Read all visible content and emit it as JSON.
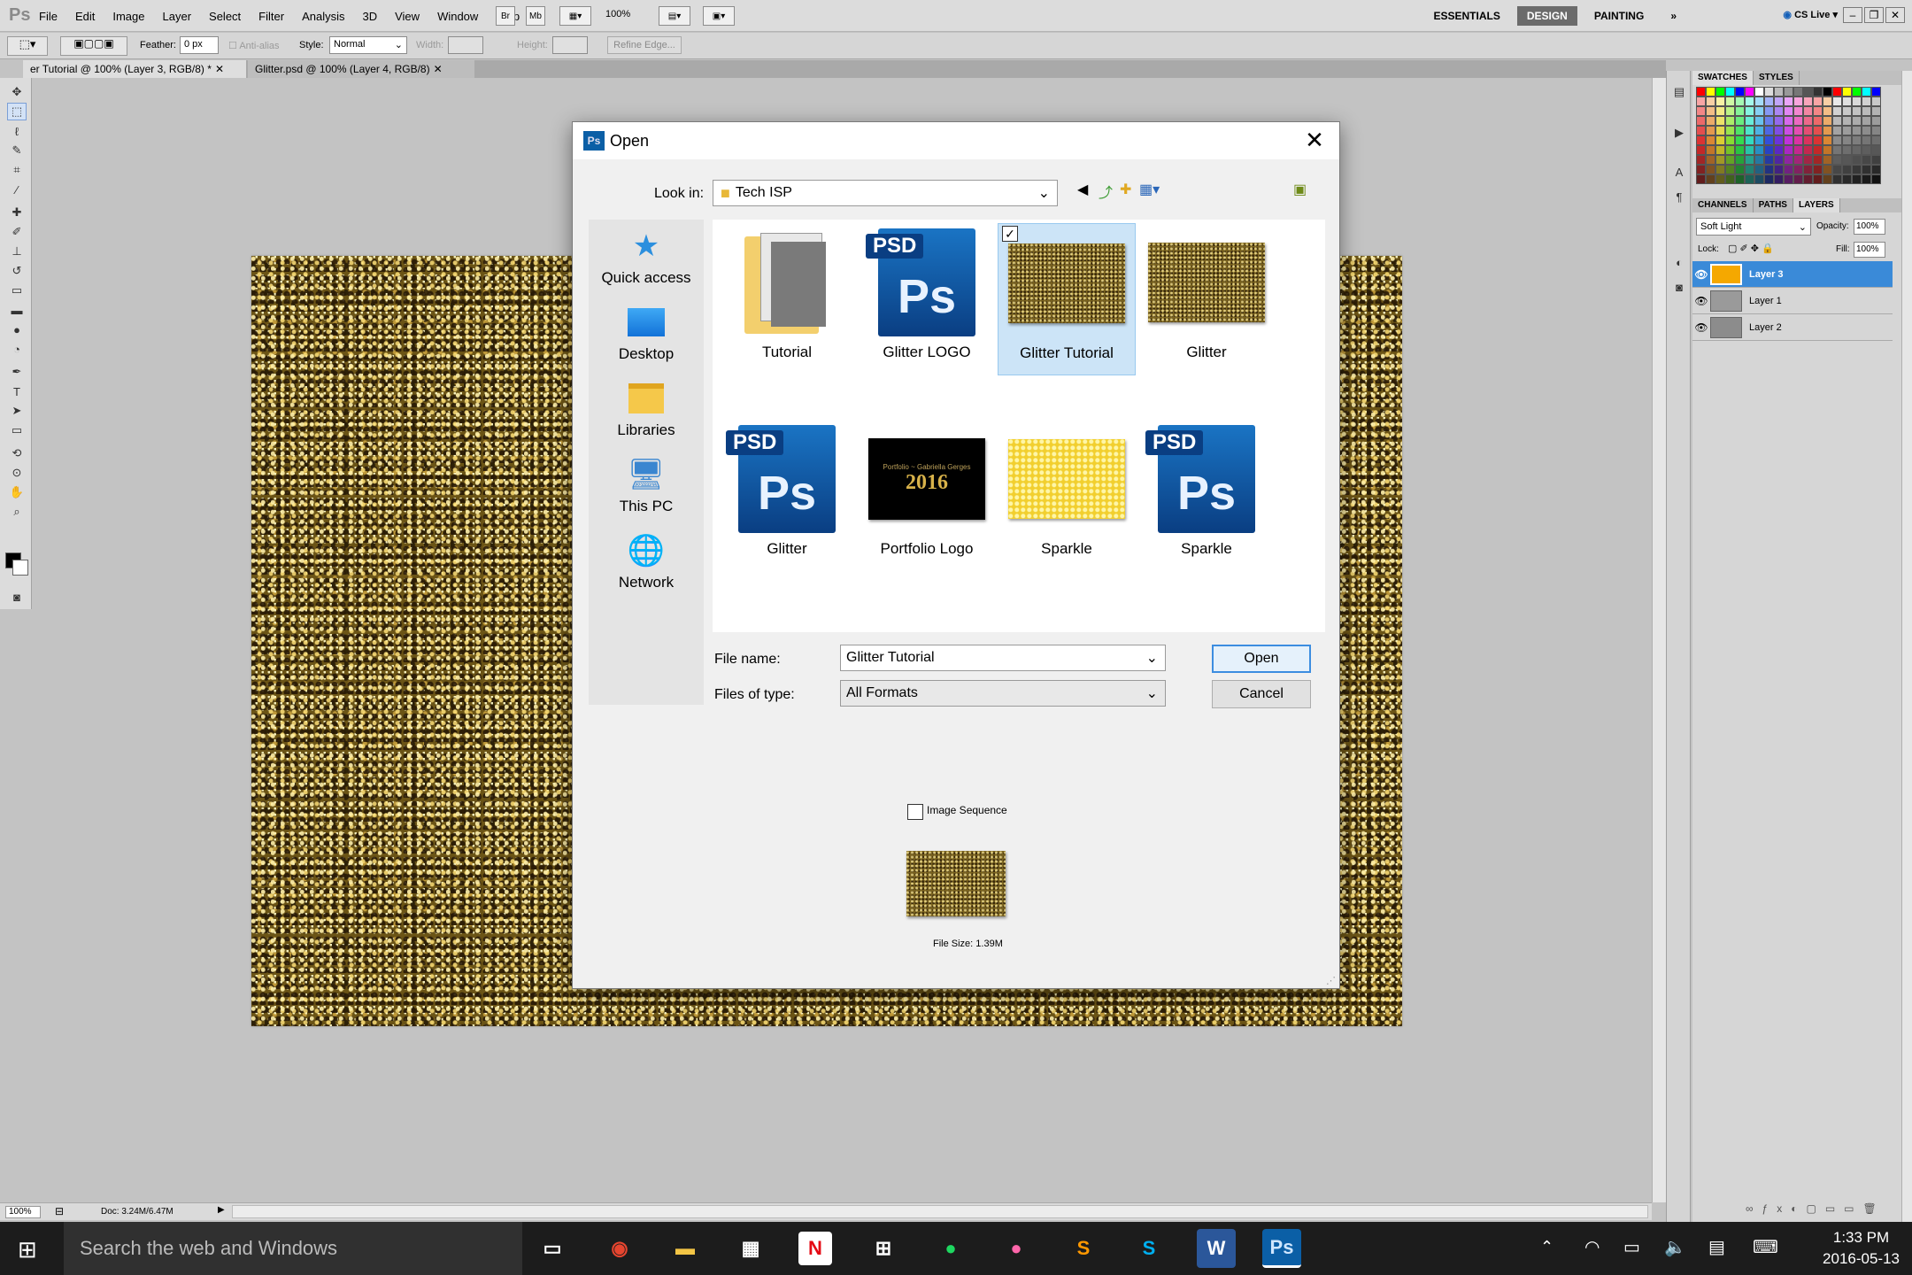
{
  "app": {
    "logo": "Ps",
    "menu": [
      "File",
      "Edit",
      "Image",
      "Layer",
      "Select",
      "Filter",
      "Analysis",
      "3D",
      "View",
      "Window",
      "Help"
    ],
    "zoom_toolbar": "100%",
    "workspaces": [
      "ESSENTIALS",
      "DESIGN",
      "PAINTING"
    ],
    "selected_workspace": "DESIGN",
    "more_workspaces": "»",
    "cslive": "CS Live"
  },
  "options_bar": {
    "feather_label": "Feather:",
    "feather_value": "0 px",
    "antialias_label": "Anti-alias",
    "style_label": "Style:",
    "style_value": "Normal",
    "width_label": "Width:",
    "height_label": "Height:",
    "refine_edge": "Refine Edge..."
  },
  "doc_tabs": [
    {
      "label": "er Tutorial @ 100% (Layer 3, RGB/8) *"
    },
    {
      "label": "Glitter.psd @ 100% (Layer 4, RGB/8)"
    }
  ],
  "panels": {
    "swatch_tabs": [
      "SWATCHES",
      "STYLES"
    ],
    "layer_tabs": [
      "CHANNELS",
      "PATHS",
      "LAYERS"
    ],
    "blend_mode": "Soft Light",
    "opacity_label": "Opacity:",
    "opacity_value": "100%",
    "lock_label": "Lock:",
    "fill_label": "Fill:",
    "fill_value": "100%",
    "layers": [
      {
        "name": "Layer 3",
        "selected": true
      },
      {
        "name": "Layer 1",
        "selected": false
      },
      {
        "name": "Layer 2",
        "selected": false
      }
    ]
  },
  "status": {
    "zoom": "100%",
    "doc": "Doc: 3.24M/6.47M"
  },
  "dialog": {
    "title": "Open",
    "look_in_label": "Look in:",
    "look_in_value": "Tech ISP",
    "places": [
      "Quick access",
      "Desktop",
      "Libraries",
      "This PC",
      "Network"
    ],
    "files": [
      {
        "name": "Tutorial",
        "kind": "folder"
      },
      {
        "name": "Glitter LOGO",
        "kind": "psd"
      },
      {
        "name": "Glitter Tutorial",
        "kind": "glitter",
        "selected": true
      },
      {
        "name": "Glitter",
        "kind": "glitter"
      },
      {
        "name": "Glitter",
        "kind": "psd"
      },
      {
        "name": "Portfolio Logo",
        "kind": "portfolio"
      },
      {
        "name": "Sparkle",
        "kind": "sparkle"
      },
      {
        "name": "Sparkle",
        "kind": "psd"
      }
    ],
    "psd_badge": "PSD",
    "ps_letters": "Ps",
    "portfolio_thumb_line": "Portfolio ~ Gabriella Gerges",
    "portfolio_thumb_year": "2016",
    "file_name_label": "File name:",
    "file_name_value": "Glitter Tutorial",
    "files_of_type_label": "Files of type:",
    "files_of_type_value": "All Formats",
    "open_button": "Open",
    "cancel_button": "Cancel",
    "image_sequence_label": "Image Sequence",
    "file_size": "File Size: 1.39M"
  },
  "taskbar": {
    "search_placeholder": "Search the web and Windows",
    "time": "1:33 PM",
    "date": "2016-05-13"
  },
  "colors": {
    "accent_selection": "#cce4f7",
    "layer_selected": "#3a8ad8",
    "workspace_selected": "#6b6b6b",
    "taskbar": "#1c1c1c"
  }
}
